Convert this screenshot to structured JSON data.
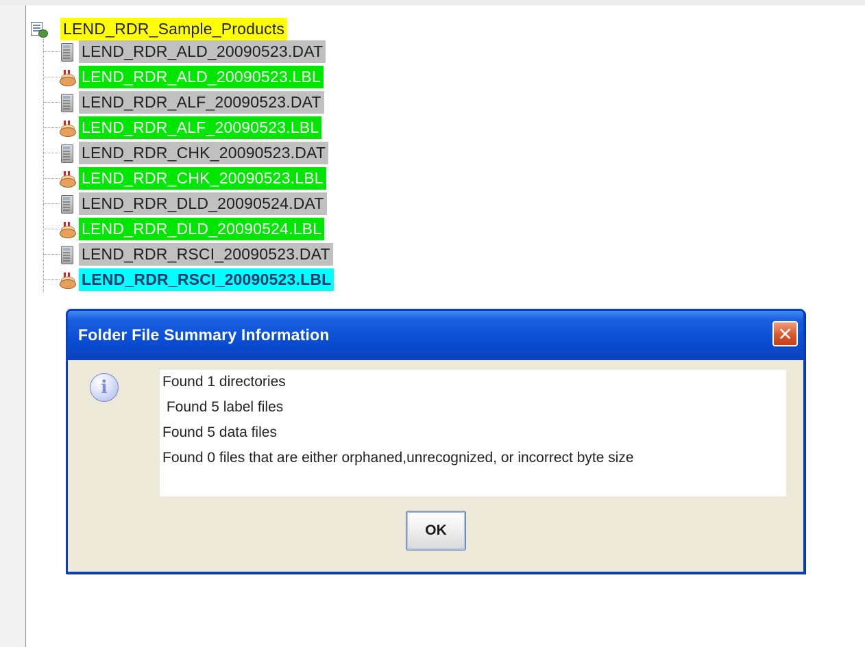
{
  "tree": {
    "root_label": "LEND_RDR_Sample_Products",
    "items": [
      {
        "label": "LEND_RDR_ALD_20090523.DAT",
        "kind": "data",
        "highlight": "#c0c0c0"
      },
      {
        "label": "LEND_RDR_ALD_20090523.LBL",
        "kind": "label",
        "highlight": "#00e600"
      },
      {
        "label": "LEND_RDR_ALF_20090523.DAT",
        "kind": "data",
        "highlight": "#c0c0c0"
      },
      {
        "label": "LEND_RDR_ALF_20090523.LBL",
        "kind": "label",
        "highlight": "#00e600"
      },
      {
        "label": "LEND_RDR_CHK_20090523.DAT",
        "kind": "data",
        "highlight": "#c0c0c0"
      },
      {
        "label": "LEND_RDR_CHK_20090523.LBL",
        "kind": "label",
        "highlight": "#00e600"
      },
      {
        "label": "LEND_RDR_DLD_20090524.DAT",
        "kind": "data",
        "highlight": "#c0c0c0"
      },
      {
        "label": "LEND_RDR_DLD_20090524.LBL",
        "kind": "label",
        "highlight": "#00e600"
      },
      {
        "label": "LEND_RDR_RSCI_20090523.DAT",
        "kind": "data",
        "highlight": "#c0c0c0"
      },
      {
        "label": "LEND_RDR_RSCI_20090523.LBL",
        "kind": "label",
        "highlight": "#00ffff"
      }
    ]
  },
  "dialog": {
    "title": "Folder File Summary Information",
    "close_icon": "close-x-icon",
    "info_icon": "information-icon",
    "info_glyph": "i",
    "close_glyph": "✕",
    "messages": [
      "Found 1 directories",
      " Found 5 label files",
      "Found 5 data files",
      "Found 0 files that are either orphaned,unrecognized, or incorrect byte size"
    ],
    "ok_label": "OK"
  },
  "colors": {
    "root_highlight": "#ffff00",
    "data_highlight": "#c0c0c0",
    "label_highlight": "#00e600",
    "selected_highlight": "#00ffff",
    "dialog_title_bar": "#0b4fd8",
    "close_button": "#d9572f"
  }
}
